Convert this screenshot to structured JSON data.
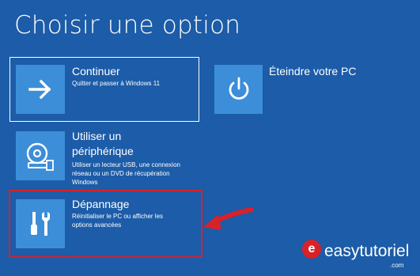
{
  "page": {
    "title": "Choisir une option"
  },
  "options": {
    "continue": {
      "title": "Continuer",
      "desc": "Quitter et passer à Windows 11",
      "icon": "arrow-right-icon"
    },
    "shutdown": {
      "title": "Éteindre votre PC",
      "icon": "power-icon"
    },
    "device": {
      "title_line1": "Utiliser un",
      "title_line2": "périphérique",
      "desc": "Utiliser un lecteur USB, une connexion réseau ou un DVD de récupération Windows",
      "icon": "disc-drive-icon"
    },
    "troubleshoot": {
      "title": "Dépannage",
      "desc": "Réinitialiser le PC ou afficher les options avancées",
      "icon": "tools-icon"
    }
  },
  "watermark": {
    "badge": "e",
    "text": "easytutoriel",
    "suffix": ".com"
  },
  "colors": {
    "background": "#1c5ca8",
    "tile": "#3c8ed8",
    "highlight": "#d9212a"
  }
}
